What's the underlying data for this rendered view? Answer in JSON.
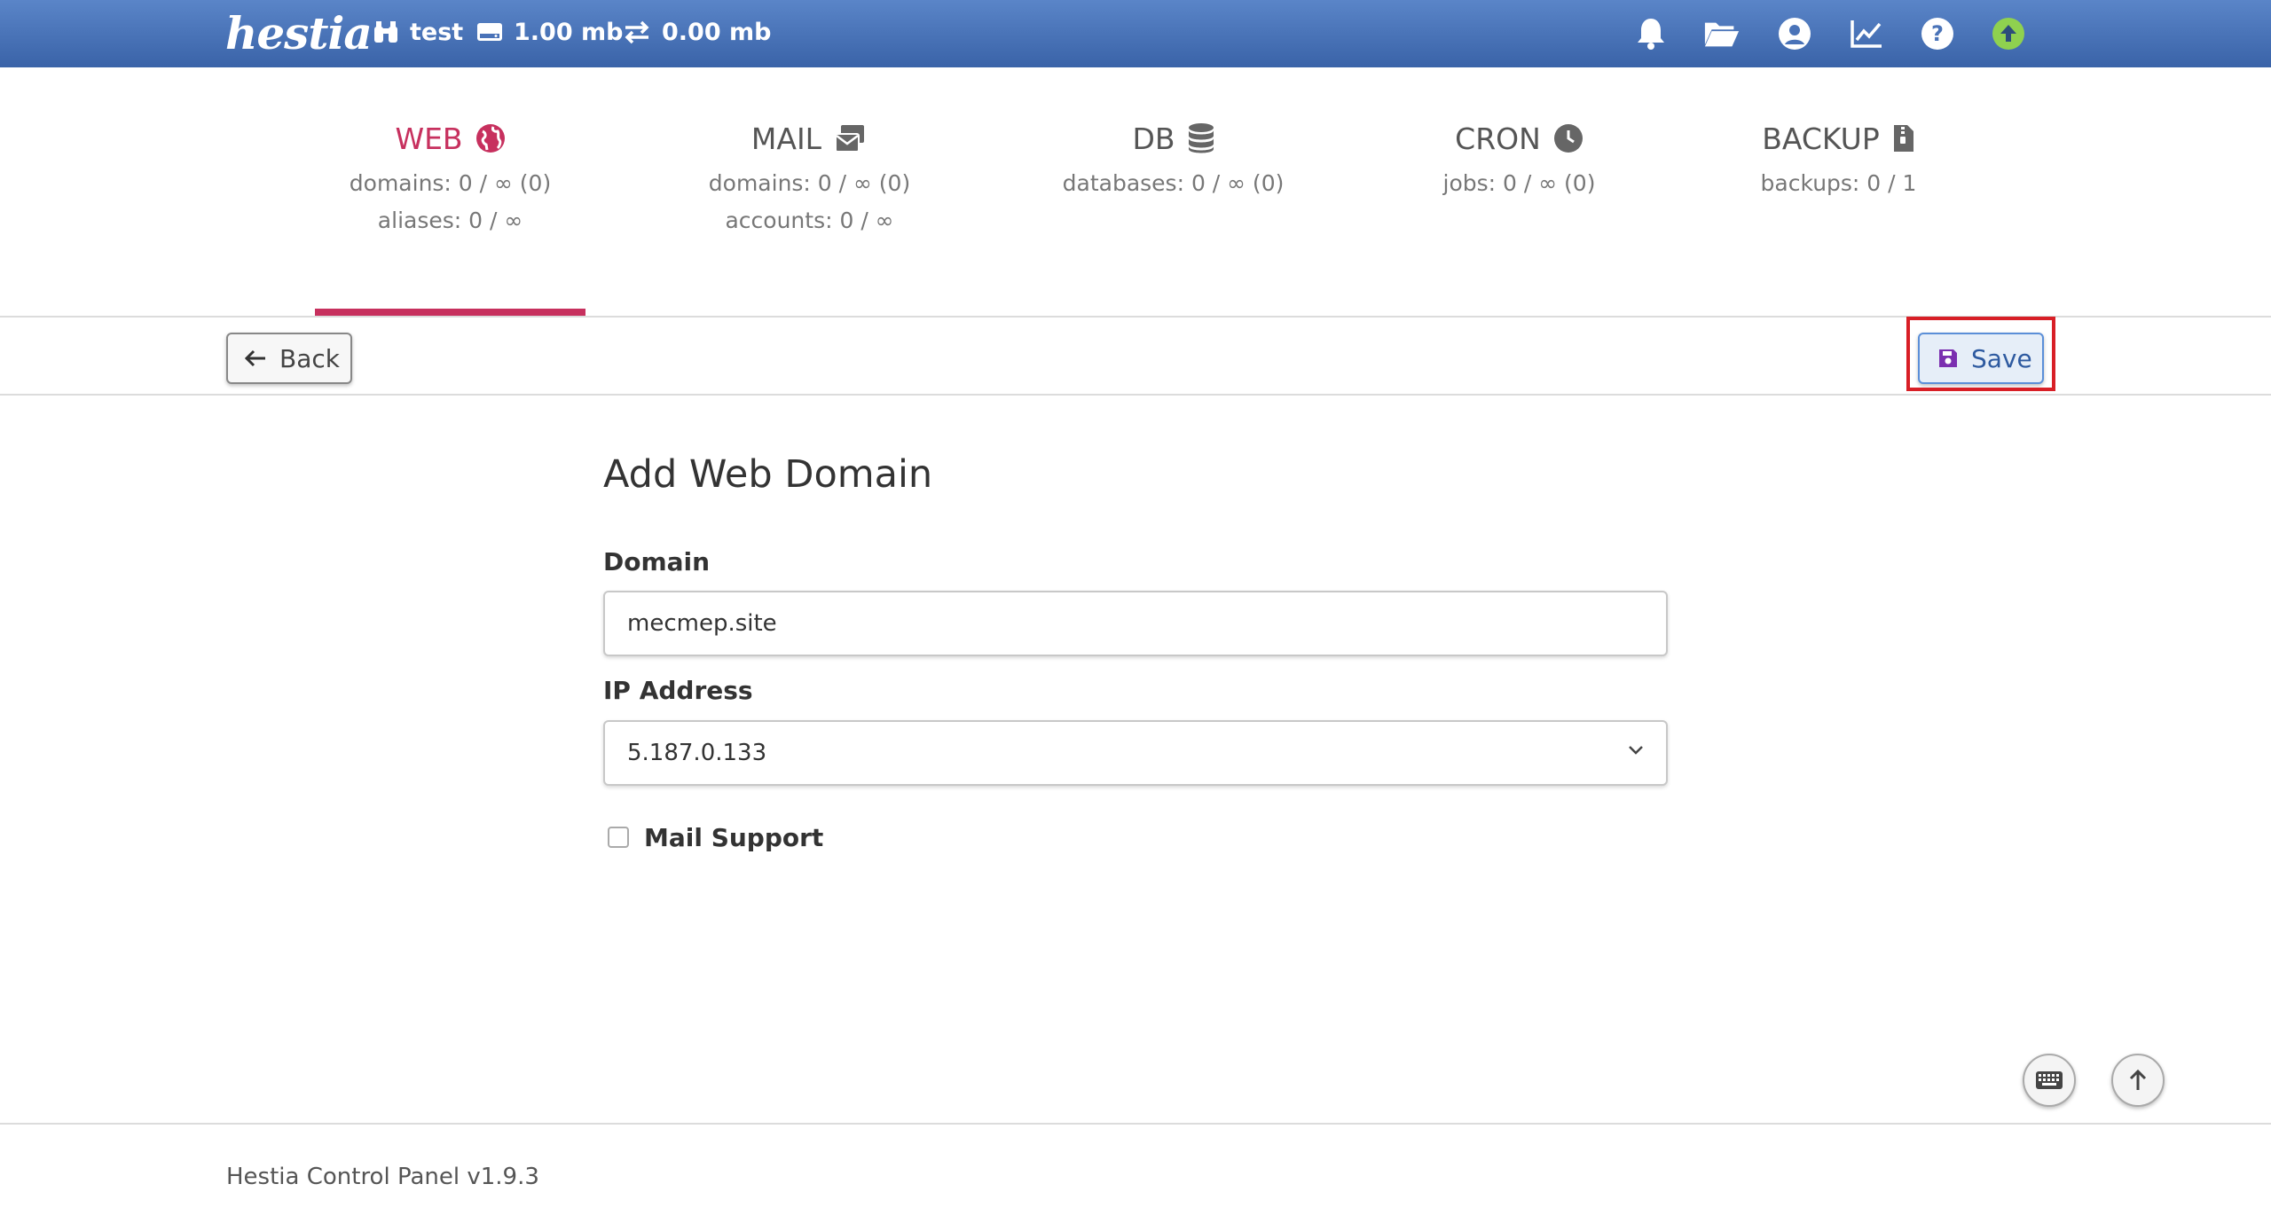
{
  "app": {
    "logo_text": "hestia"
  },
  "topbar": {
    "user": "test",
    "disk": "1.00 mb",
    "bandwidth": "0.00 mb",
    "icons": [
      "bell-icon",
      "folder-open-icon",
      "user-circle-icon",
      "chart-line-icon",
      "question-circle-icon",
      "update-arrow-icon"
    ],
    "update_color": "#8fd14f"
  },
  "tabs": [
    {
      "title": "WEB",
      "icon": "globe-icon",
      "lines": [
        "domains: 0 / ∞ (0)",
        "aliases: 0 / ∞"
      ],
      "active": true
    },
    {
      "title": "MAIL",
      "icon": "mail-stack-icon",
      "lines": [
        "domains: 0 / ∞ (0)",
        "accounts: 0 / ∞"
      ],
      "active": false
    },
    {
      "title": "DB",
      "icon": "database-icon",
      "lines": [
        "databases: 0 / ∞ (0)"
      ],
      "active": false
    },
    {
      "title": "CRON",
      "icon": "clock-icon",
      "lines": [
        "jobs: 0 / ∞ (0)"
      ],
      "active": false
    },
    {
      "title": "BACKUP",
      "icon": "file-zip-icon",
      "lines": [
        "backups: 0 / 1"
      ],
      "active": false
    }
  ],
  "toolbar": {
    "back_label": "Back",
    "save_label": "Save"
  },
  "form": {
    "title": "Add Web Domain",
    "domain_label": "Domain",
    "domain_value": "mecmep.site",
    "ip_label": "IP Address",
    "ip_value": "5.187.0.133",
    "mail_support_label": "Mail Support",
    "mail_support_checked": false
  },
  "footer": {
    "text": "Hestia Control Panel v1.9.3"
  },
  "colors": {
    "accent": "#c7305e",
    "topbar": "#4a73b8",
    "highlight": "#d81f26"
  }
}
